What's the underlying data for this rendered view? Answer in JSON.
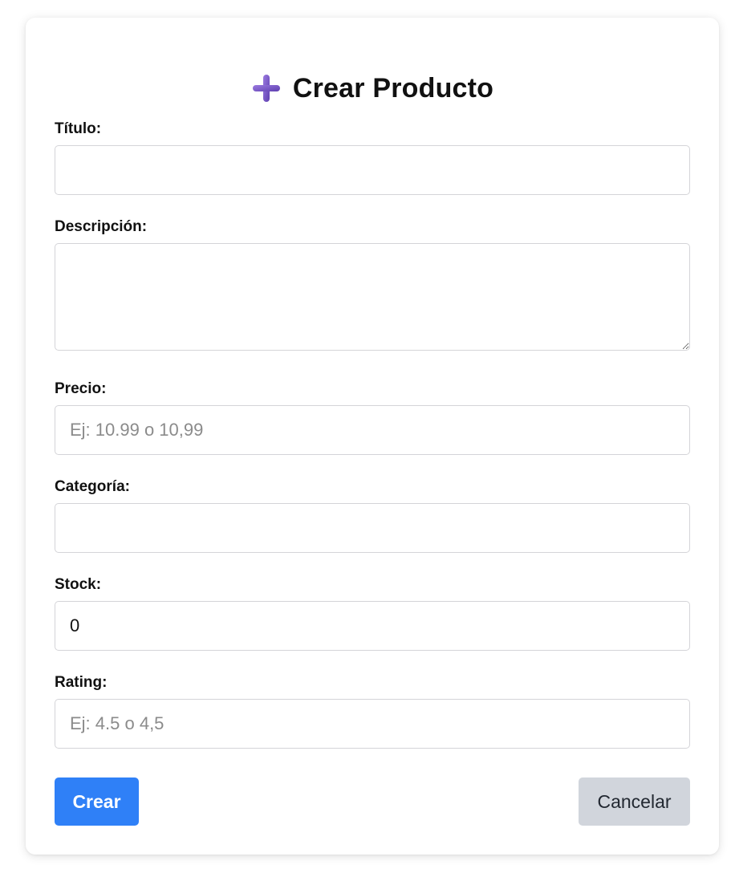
{
  "form": {
    "title": "Crear Producto",
    "title_icon": "heavy-plus-icon",
    "accent_color": "#7c56c7",
    "fields": {
      "titulo": {
        "label": "Título:",
        "value": "",
        "placeholder": ""
      },
      "descripcion": {
        "label": "Descripción:",
        "value": "",
        "placeholder": ""
      },
      "precio": {
        "label": "Precio:",
        "value": "",
        "placeholder": "Ej: 10.99 o 10,99"
      },
      "categoria": {
        "label": "Categoría:",
        "value": "",
        "placeholder": ""
      },
      "stock": {
        "label": "Stock:",
        "value": "0",
        "placeholder": ""
      },
      "rating": {
        "label": "Rating:",
        "value": "",
        "placeholder": "Ej: 4.5 o 4,5"
      }
    },
    "buttons": {
      "create": {
        "label": "Crear",
        "color": "#2f80f7"
      },
      "cancel": {
        "label": "Cancelar",
        "color": "#d1d5dc"
      }
    }
  }
}
